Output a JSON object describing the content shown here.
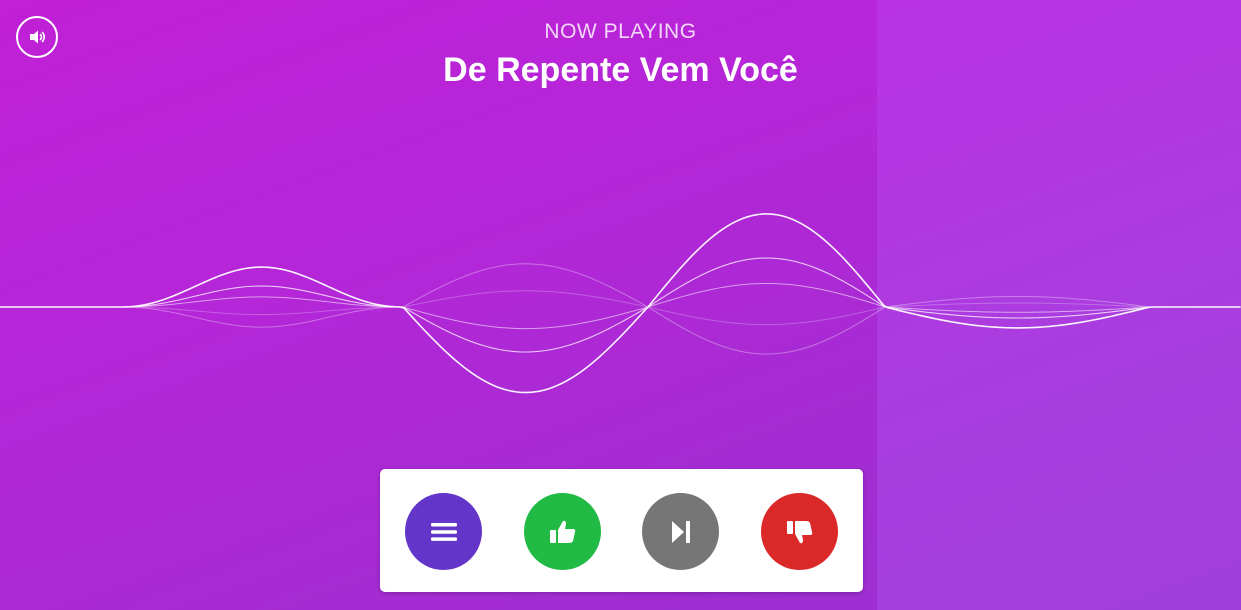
{
  "header": {
    "label": "NOW PLAYING",
    "song_title": "De Repente Vem Você"
  },
  "colors": {
    "background_left": "#b526d8",
    "background_right": "#a93ddf",
    "menu_button": "#6435c9",
    "like_button": "#21ba45",
    "skip_button": "#767676",
    "dislike_button": "#db2828"
  },
  "icons": {
    "volume": "volume-icon",
    "menu": "menu-icon",
    "like": "thumbs-up-icon",
    "skip": "skip-forward-icon",
    "dislike": "thumbs-down-icon"
  }
}
